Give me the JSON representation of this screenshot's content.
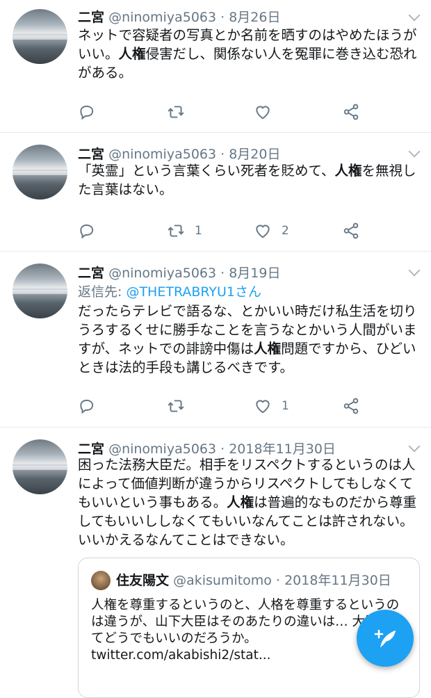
{
  "tweets": [
    {
      "name": "二宮",
      "handle": "@ninomiya5063",
      "sep": "·",
      "date": "8月26日",
      "text_before": "ネットで容疑者の写真とか名前を晒すのはやめたほうがいい。",
      "highlight": "人権",
      "text_after": "侵害だし、関係ない人を冤罪に巻き込む恐れがある。",
      "retweets": "",
      "likes": ""
    },
    {
      "name": "二宮",
      "handle": "@ninomiya5063",
      "sep": "·",
      "date": "8月20日",
      "text_before": "「英霊」という言葉くらい死者を貶めて、",
      "highlight": "人権",
      "text_after": "を無視した言葉はない。",
      "retweets": "1",
      "likes": "2"
    },
    {
      "name": "二宮",
      "handle": "@ninomiya5063",
      "sep": "·",
      "date": "8月19日",
      "reply_prefix": "返信先:",
      "reply_to": "@THETRABRYU1さん",
      "text_before": "だったらテレビで語るな、とかいい時だけ私生活を切りうろするくせに勝手なことを言うなとかいう人間がいますが、ネットでの誹謗中傷は",
      "highlight": "人権",
      "text_after": "問題ですから、ひどいときは法的手段も講じるべきです。",
      "retweets": "",
      "likes": "1"
    },
    {
      "name": "二宮",
      "handle": "@ninomiya5063",
      "sep": "·",
      "date": "2018年11月30日",
      "text_before": "困った法務大臣だ。相手をリスペクトするというのは人によって価値判断が違うからリスペクトしてもしなくてもいいという事もある。",
      "highlight": "人権",
      "text_after": "は普遍的なものだから尊重してもいいししなくてもいいなんてことは許されない。いいかえるなんてことはできない。",
      "quote": {
        "name": "住友陽文",
        "handle": "@akisumitomo",
        "sep": "·",
        "date": "2018年11月30日",
        "text": "人権を尊重するというのと、人格を尊重するというのは違うが、山下大臣はそのあたりの違いは… 大臣としてどうでもいいのだろうか。 twitter.com/akabishi2/stat..."
      }
    }
  ],
  "icons": {
    "reply": "reply-icon",
    "retweet": "retweet-icon",
    "like": "heart-icon",
    "share": "share-icon",
    "more": "chevron-down-icon",
    "compose": "compose-tweet-icon"
  },
  "colors": {
    "accent": "#1da1f2",
    "secondary_text": "#657786",
    "divider": "#e6ecf0"
  }
}
